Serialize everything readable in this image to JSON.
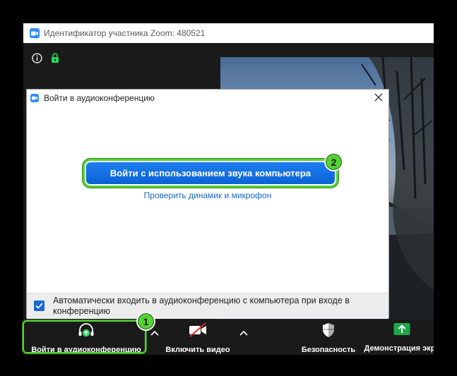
{
  "window": {
    "title": "Идентификатор участника Zoom: 480521"
  },
  "dialog": {
    "title": "Войти в аудиоконференцию",
    "join_computer_audio_label": "Войти с использованием звука компьютера",
    "test_speaker_link": "Проверить динамик и микрофон",
    "auto_join": {
      "checked": true,
      "label": "Автоматически входить в аудиоконференцию с компьютера при входе в конференцию"
    }
  },
  "toolbar": {
    "join_audio_label": "Войти в аудиоконференцию",
    "start_video_label": "Включить видео",
    "security_label": "Безопасность",
    "share_screen_label": "Демонстрация экра"
  },
  "annotations": {
    "step1": "1",
    "step2": "2"
  },
  "colors": {
    "zoom_blue": "#2d8cff",
    "button_blue": "#0e6ee0",
    "annotation_green": "#55d234",
    "security_lock_green": "#23d959",
    "share_green": "#1fa84a",
    "toolbar_bg": "#1a1a1a"
  }
}
